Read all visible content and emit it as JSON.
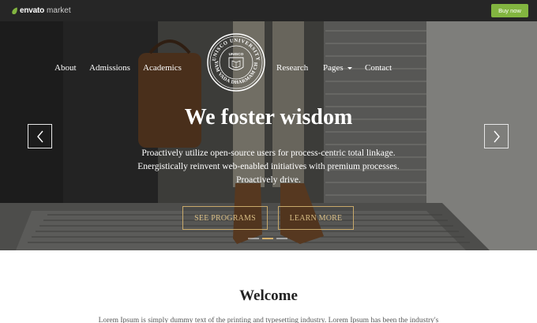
{
  "envato": {
    "brand": "envato",
    "market": "market",
    "buy_label": "Buy now",
    "accent_color": "#82b540"
  },
  "nav": {
    "items": [
      {
        "label": "About"
      },
      {
        "label": "Admissions"
      },
      {
        "label": "Academics"
      },
      {
        "label": "Research"
      },
      {
        "label": "Pages"
      },
      {
        "label": "Contact"
      }
    ],
    "logo_icon": "university-seal-icon",
    "logo_top_text": "UNISCO UNIVERSITY",
    "logo_inner_text": "UNISCO",
    "logo_bottom_text": "SATYAM VADA DHARMAM CHARA"
  },
  "hero": {
    "title": "We foster wisdom",
    "subtitle": "Proactively utilize open-source users for process-centric total linkage. Energistically reinvent web-enabled initiatives with premium processes. Proactively drive.",
    "button_programs": "SEE PROGRAMS",
    "button_learn": "LEARN MORE",
    "accent_color": "#c8a96a",
    "prev_icon": "chevron-left-icon",
    "next_icon": "chevron-right-icon",
    "slide_count": 3,
    "active_slide": 2
  },
  "welcome": {
    "title": "Welcome",
    "text": "Lorem Ipsum is simply dummy text of the printing and typesetting industry. Lorem Ipsum has been the industry's"
  }
}
